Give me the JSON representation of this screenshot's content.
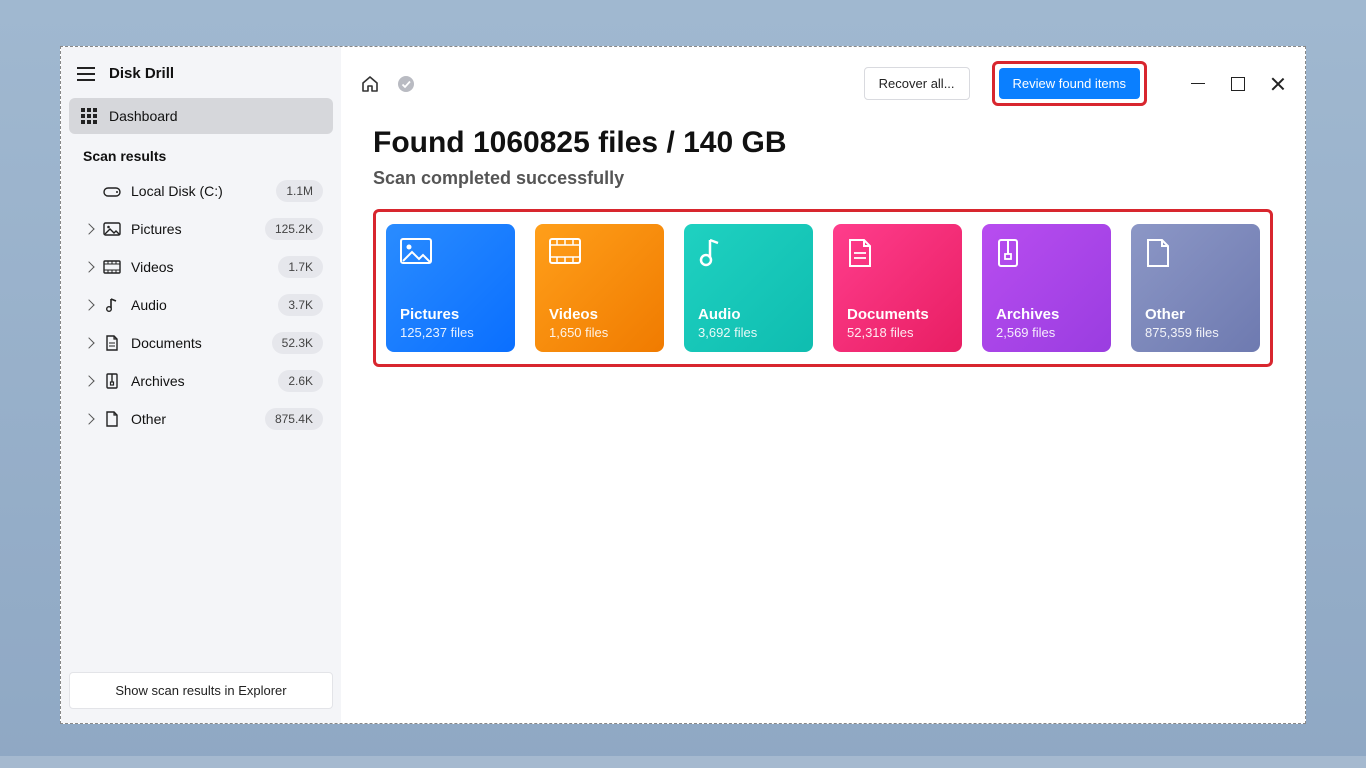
{
  "app": {
    "title": "Disk Drill"
  },
  "sidebar": {
    "dashboard": "Dashboard",
    "section_label": "Scan results",
    "items": [
      {
        "label": "Local Disk (C:)",
        "count": "1.1M"
      },
      {
        "label": "Pictures",
        "count": "125.2K"
      },
      {
        "label": "Videos",
        "count": "1.7K"
      },
      {
        "label": "Audio",
        "count": "3.7K"
      },
      {
        "label": "Documents",
        "count": "52.3K"
      },
      {
        "label": "Archives",
        "count": "2.6K"
      },
      {
        "label": "Other",
        "count": "875.4K"
      }
    ],
    "explorer_button": "Show scan results in Explorer"
  },
  "toolbar": {
    "recover_all": "Recover all...",
    "review": "Review found items"
  },
  "main": {
    "headline": "Found 1060825 files / 140 GB",
    "subline": "Scan completed successfully",
    "cards": [
      {
        "title": "Pictures",
        "sub": "125,237 files"
      },
      {
        "title": "Videos",
        "sub": "1,650 files"
      },
      {
        "title": "Audio",
        "sub": "3,692 files"
      },
      {
        "title": "Documents",
        "sub": "52,318 files"
      },
      {
        "title": "Archives",
        "sub": "2,569 files"
      },
      {
        "title": "Other",
        "sub": "875,359 files"
      }
    ]
  }
}
